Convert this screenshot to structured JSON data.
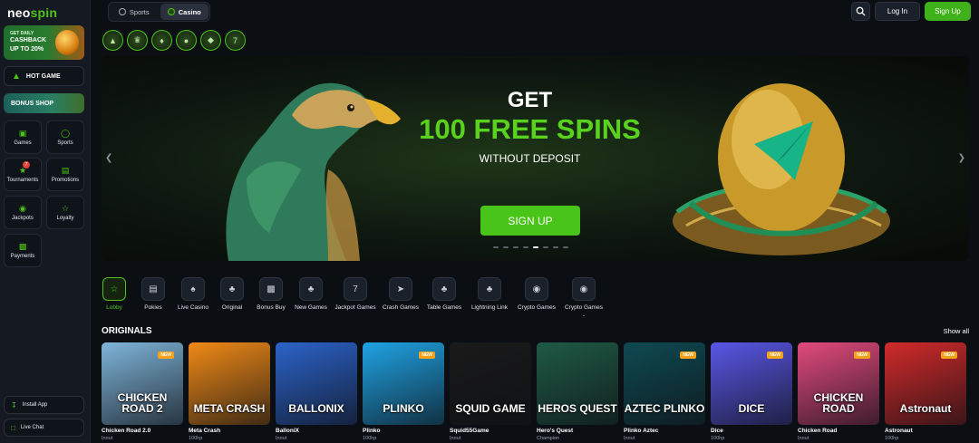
{
  "logo": {
    "part1": "neo",
    "part2": "spin"
  },
  "sidebar": {
    "promo": {
      "line1": "GET DAILY",
      "line2": "CASHBACK",
      "line3": "UP TO 20%"
    },
    "hot_game": "HOT GAME",
    "bonus_shop": "BONUS SHOP",
    "tiles": [
      {
        "label": "Games"
      },
      {
        "label": "Sports"
      },
      {
        "label": "Tournaments",
        "badge": "7"
      },
      {
        "label": "Promotions"
      },
      {
        "label": "Jackpots"
      },
      {
        "label": "Loyalty"
      },
      {
        "label": "Payments"
      }
    ],
    "install_app": "Install App",
    "live_chat": "Live Chat"
  },
  "header": {
    "tabs": [
      {
        "label": "Sports"
      },
      {
        "label": "Casino"
      }
    ],
    "login": "Log In",
    "signup": "Sign Up"
  },
  "banner": {
    "get": "GET",
    "headline": "100 FREE SPINS",
    "sub": "WITHOUT DEPOSIT",
    "cta": "SIGN UP",
    "accent": "#58d21e"
  },
  "categories": [
    "Lobby",
    "Pokies",
    "Live Casino",
    "Original",
    "Bonus Buy",
    "New Games",
    "Jackpot Games",
    "Crash Games",
    "Table Games",
    "Lightning Link",
    "Crypto Games",
    "Crypto Games"
  ],
  "originals": {
    "title": "ORIGINALS",
    "show_all": "Show all",
    "games": [
      {
        "name": "Chicken Road 2.0",
        "provider": "Inout",
        "art": "CHICKEN ROAD 2",
        "new": "NEW",
        "bg": "#7fb5d9"
      },
      {
        "name": "Meta Crash",
        "provider": "100hp",
        "art": "META CRASH",
        "new": "",
        "bg": "#f08a17"
      },
      {
        "name": "BalloniX",
        "provider": "Inout",
        "art": "BALLONIX",
        "new": "",
        "bg": "#2c63c9"
      },
      {
        "name": "Plinko",
        "provider": "100hp",
        "art": "PLINKO",
        "new": "NEW",
        "bg": "#1fa3e3"
      },
      {
        "name": "Squid55Game",
        "provider": "Inout",
        "art": "SQUID GAME",
        "new": "",
        "bg": "#1a1a1a"
      },
      {
        "name": "Hero's Quest",
        "provider": "Champion",
        "art": "HEROS QUEST",
        "new": "",
        "bg": "#1f5a45"
      },
      {
        "name": "Plinko Aztec",
        "provider": "Inout",
        "art": "AZTEC PLINKO",
        "new": "NEW",
        "bg": "#0f4a52"
      },
      {
        "name": "Dice",
        "provider": "100hp",
        "art": "DICE",
        "new": "NEW",
        "bg": "#5a57e6"
      },
      {
        "name": "Chicken Road",
        "provider": "Inout",
        "art": "CHICKEN ROAD",
        "new": "NEW",
        "bg": "#e24a7d"
      },
      {
        "name": "Astronaut",
        "provider": "100hp",
        "art": "Astronaut",
        "new": "NEW",
        "bg": "#d22a2a"
      }
    ]
  }
}
